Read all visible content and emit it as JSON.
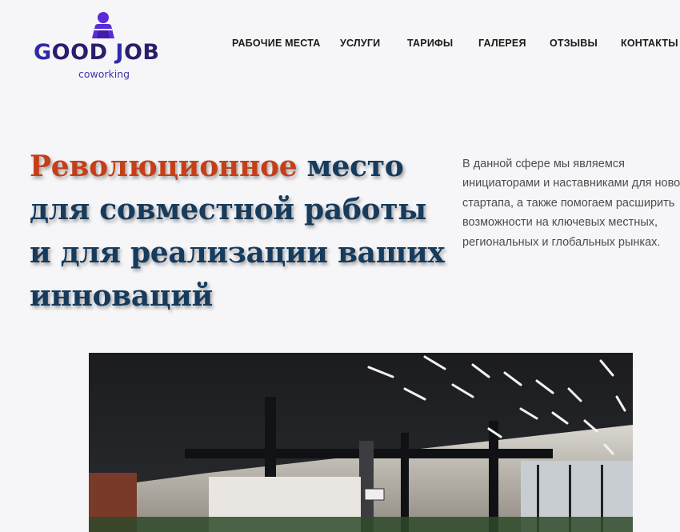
{
  "logo": {
    "word_part1_letter": "G",
    "word_part1_rest": "OOD ",
    "word_part2_letter": "J",
    "word_part2_rest": "OB",
    "subtitle": "coworking",
    "icon": "person-laptop-icon"
  },
  "nav": {
    "items": [
      "РАБОЧИЕ МЕСТА",
      "УСЛУГИ",
      "ТАРИФЫ",
      "ГАЛЕРЕЯ",
      "ОТЗЫВЫ",
      "КОНТАКТЫ"
    ]
  },
  "hero": {
    "title_accent": "Революционное",
    "title_rest": " место для совместной работы и для реализации ваших инноваций",
    "description": "В данной сфере мы являемся инициаторами и наставниками для нового стартапа, а также помогаем расширить возможности на ключевых местных, региональных и глобальных рынках."
  },
  "colors": {
    "background": "#f6f5f7",
    "accent": "#c43f18",
    "heading": "#163b5c",
    "brand": "#2e2aa8"
  }
}
